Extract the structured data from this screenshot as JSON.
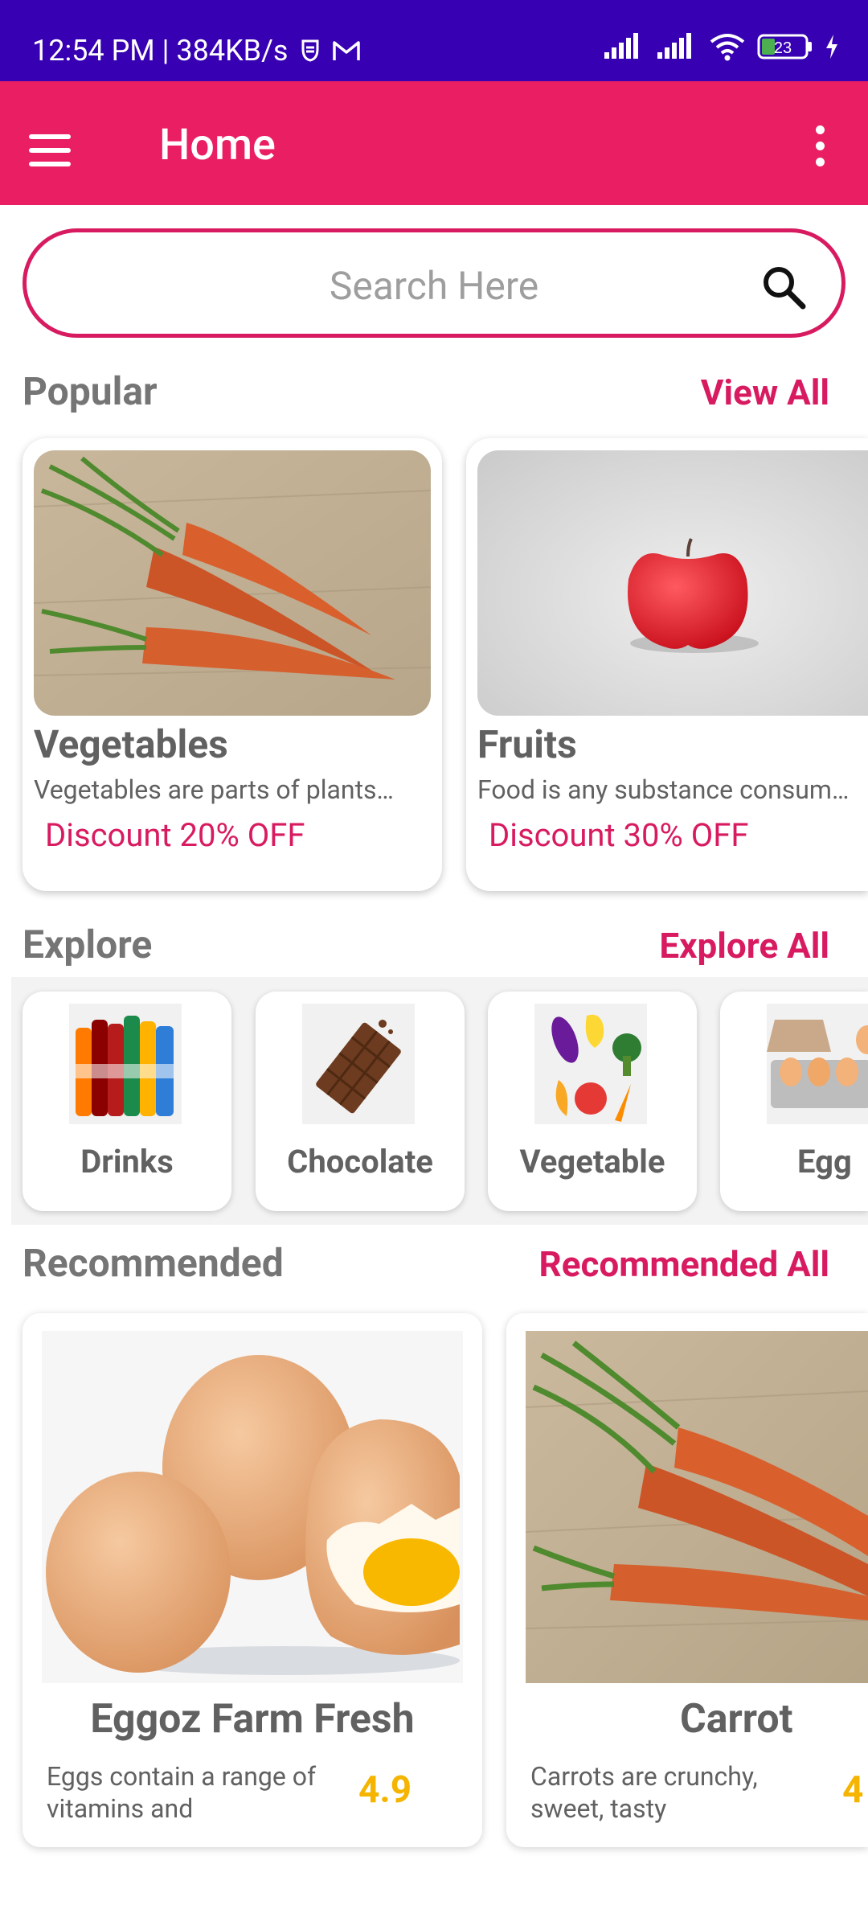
{
  "status_bar": {
    "time_speed": "12:54 PM | 384KB/s",
    "battery": "23"
  },
  "app_bar": {
    "title": "Home"
  },
  "search": {
    "placeholder": "Search Here"
  },
  "popular": {
    "title": "Popular",
    "link": "View All",
    "items": [
      {
        "title": "Vegetables",
        "desc": "Vegetables are parts of plants…",
        "discount": "Discount 20% OFF"
      },
      {
        "title": "Fruits",
        "desc": "Food is any substance consum…",
        "discount": "Discount 30% OFF"
      }
    ]
  },
  "explore": {
    "title": "Explore",
    "link": "Explore All",
    "items": [
      {
        "label": "Drinks"
      },
      {
        "label": "Chocolate"
      },
      {
        "label": "Vegetable"
      },
      {
        "label": "Egg"
      }
    ]
  },
  "recommended": {
    "title": "Recommended",
    "link": "Recommended All",
    "items": [
      {
        "title": "Eggoz Farm Fresh",
        "desc": "Eggs contain a range of vitamins and",
        "rating": "4.9"
      },
      {
        "title": "Carrot",
        "desc": "Carrots are crunchy, sweet, tasty",
        "rating": "4"
      }
    ]
  },
  "colors": {
    "status_bar": "#3700b3",
    "primary": "#e91e63",
    "accent": "#d81b60",
    "rating": "#f5b400"
  }
}
